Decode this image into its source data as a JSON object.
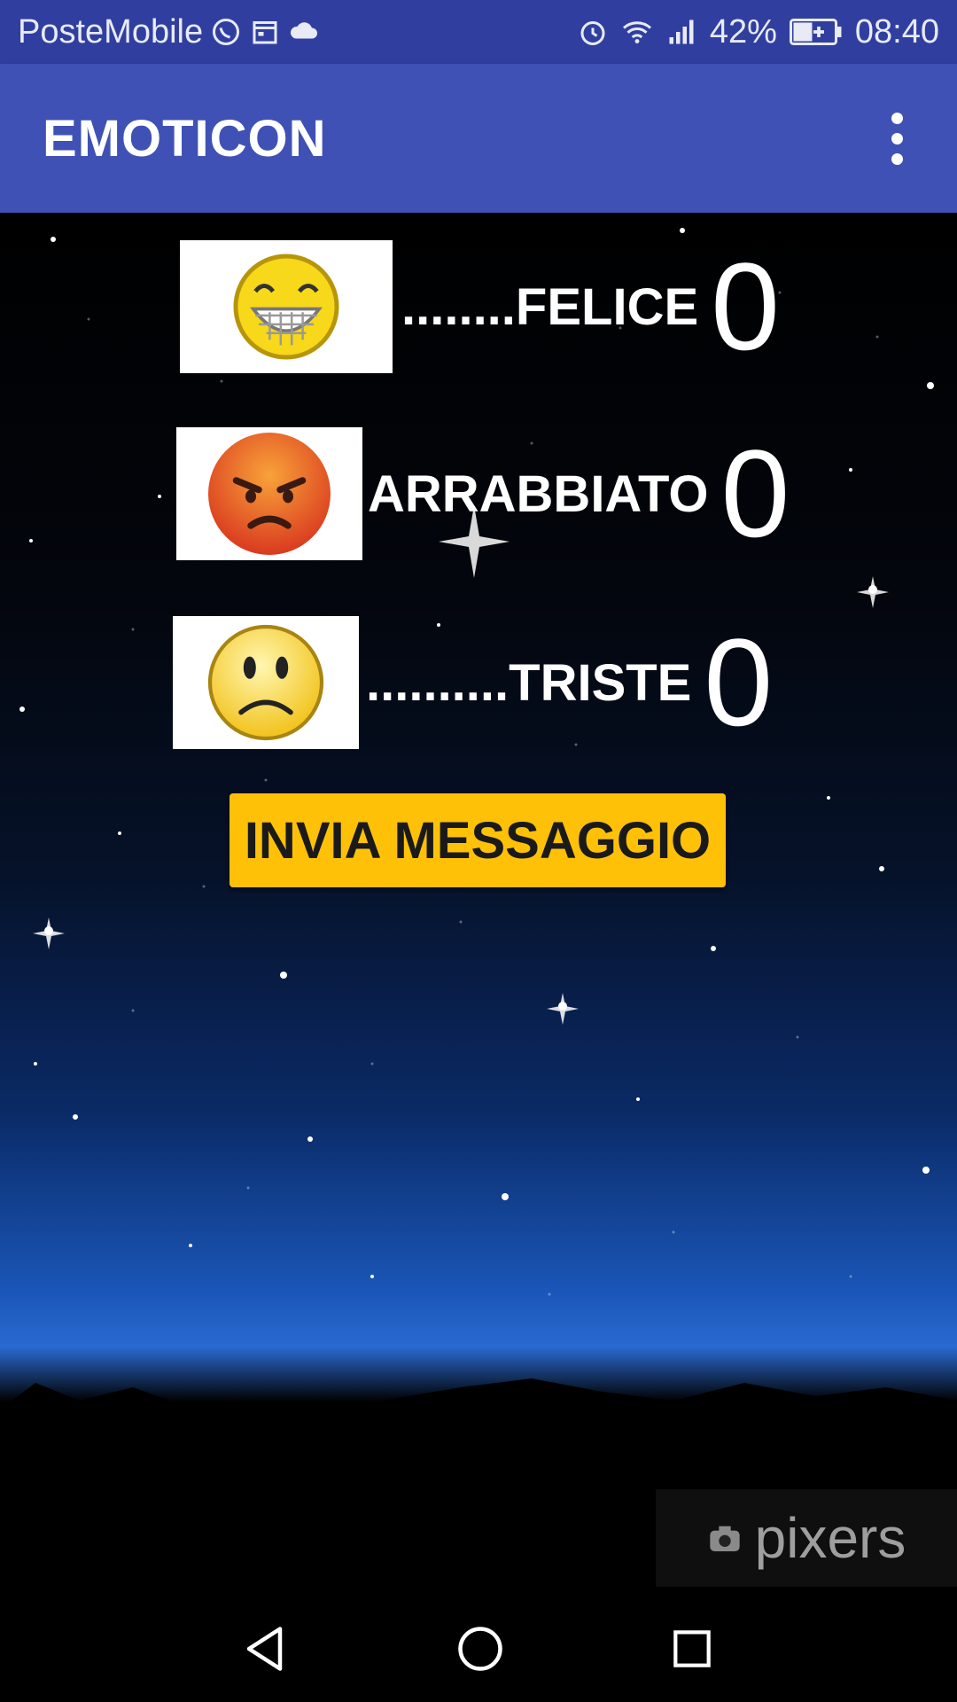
{
  "status_bar": {
    "carrier": "PosteMobile",
    "battery": "42%",
    "time": "08:40",
    "icons": [
      "whatsapp-icon",
      "calendar-icon",
      "cloud-icon",
      "alarm-icon",
      "wifi-icon",
      "signal-icon",
      "battery-charging-icon"
    ]
  },
  "app_bar": {
    "title": "EMOTICON",
    "menu_icon": "more-vert-icon"
  },
  "emoticons": [
    {
      "name": "happy-emoji",
      "label": "........FELICE",
      "count": "0"
    },
    {
      "name": "angry-emoji",
      "label": "ARRABBIATO",
      "count": "0"
    },
    {
      "name": "sad-emoji",
      "label": "..........TRISTE",
      "count": "0"
    }
  ],
  "send_button": {
    "label": "INVIA MESSAGGIO"
  },
  "watermark": {
    "text": "pixers"
  },
  "nav_bar": {
    "icons": [
      "back-icon",
      "home-icon",
      "recents-icon"
    ]
  },
  "colors": {
    "status_bar": "#303f9f",
    "app_bar": "#3f51b5",
    "button": "#ffc107"
  }
}
